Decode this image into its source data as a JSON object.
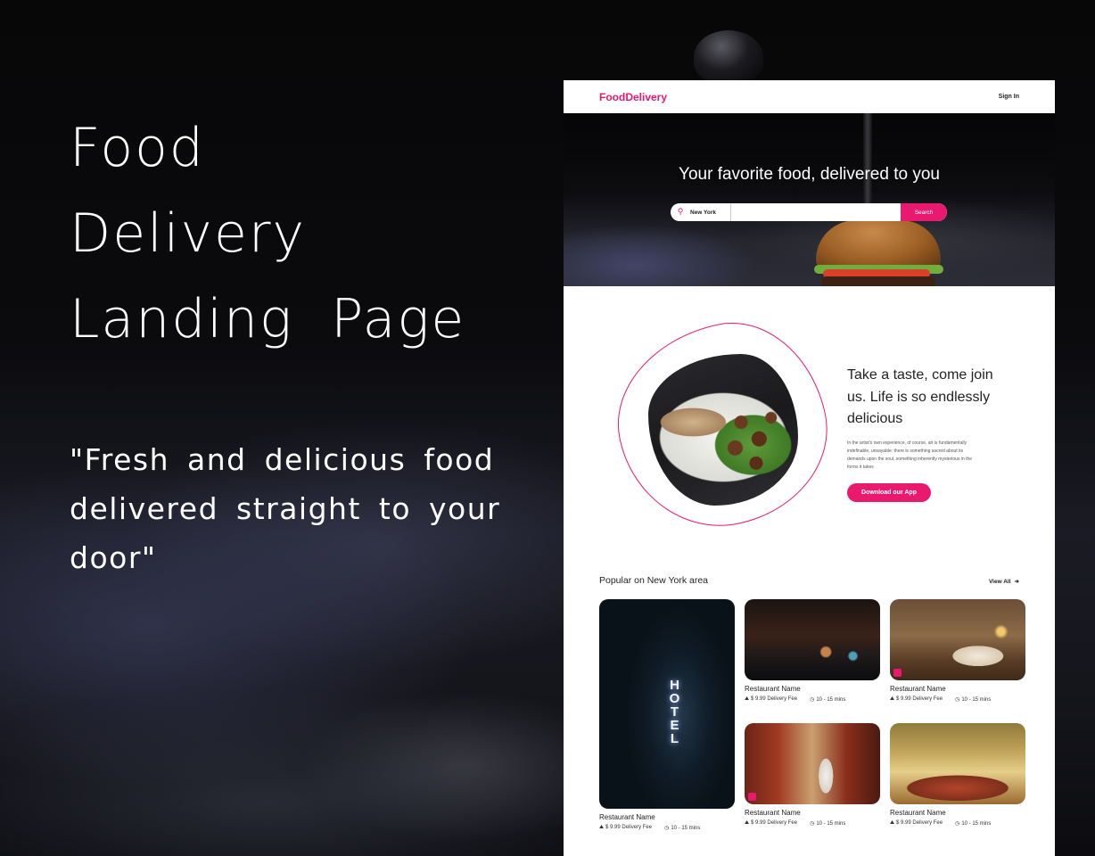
{
  "showcase": {
    "title_lines": [
      "Food",
      "Delivery",
      "Landing  Page"
    ],
    "quote": "\"Fresh and delicious food delivered straight to your door\""
  },
  "site": {
    "brand": "FoodDelivery",
    "nav": {
      "signin_label": "Sign In"
    },
    "hero": {
      "headline": "Your favorite food, delivered to you",
      "search": {
        "location_value": "New York",
        "button_label": "Search"
      }
    },
    "about": {
      "heading": "Take a taste, come join us. Life is so endlessly delicious",
      "body": "In the artist's own experience, of course, art is fundamentally indefinable, unsayable: there is something sacred about its demands upon the soul, something inherently mysterious in the forms it takes",
      "cta_label": "Download our App"
    },
    "popular": {
      "heading": "Popular on New York area",
      "view_all_label": "View All",
      "restaurants": [
        {
          "name": "Restaurant Name",
          "fee": "$ 9.99 Delivery Fee",
          "time": "10 - 15 mins",
          "sign": "HOTEL"
        },
        {
          "name": "Restaurant Name",
          "fee": "$ 9.99 Delivery Fee",
          "time": "10 - 15 mins"
        },
        {
          "name": "Restaurant Name",
          "fee": "$ 9.99 Delivery Fee",
          "time": "10 - 15 mins"
        },
        {
          "name": "Restaurant Name",
          "fee": "$ 9.99 Delivery Fee",
          "time": "10 - 15 mins"
        },
        {
          "name": "Restaurant Name",
          "fee": "$ 9.99 Delivery Fee",
          "time": "10 - 15 mins"
        }
      ]
    }
  },
  "colors": {
    "accent": "#e8196e",
    "dark": "#0b0b0d"
  },
  "icons": [
    "location-pin-icon",
    "arrow-right-icon",
    "bike-icon",
    "clock-icon"
  ]
}
